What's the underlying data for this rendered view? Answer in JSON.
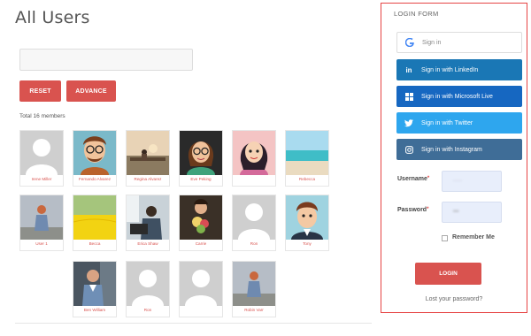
{
  "header": {
    "title": "All Users"
  },
  "search": {
    "value": "",
    "placeholder": ""
  },
  "filters": {
    "reset_label": "RESET",
    "advance_label": "ADVANCE"
  },
  "summary": {
    "total_text": "Total 16 members"
  },
  "members": [
    {
      "name": "Irene Miller",
      "photo": "default-avatar"
    },
    {
      "name": "Fernando Alvarez",
      "photo": "cartoon-man-glasses"
    },
    {
      "name": "Regina Alvarez",
      "photo": "woman-on-bench"
    },
    {
      "name": "Eve Peking",
      "photo": "cartoon-woman-glasses"
    },
    {
      "name": "",
      "photo": "cartoon-woman-dark-hair",
      "blurred": true
    },
    {
      "name": "Rebecca",
      "photo": "beach"
    },
    {
      "name": "User 1",
      "photo": "girl-back-view"
    },
    {
      "name": "Becca",
      "photo": "yellow-flower-field"
    },
    {
      "name": "Erica Shaw",
      "photo": "woman-at-desk"
    },
    {
      "name": "Carrie",
      "photo": "woman-with-flowers"
    },
    {
      "name": "Ron",
      "photo": "default-avatar"
    },
    {
      "name": "Tony",
      "photo": "cartoon-man-suit"
    },
    {
      "name": "Ben William",
      "photo": "man-in-office"
    },
    {
      "name": "Ron",
      "photo": "default-avatar"
    },
    {
      "name": "",
      "photo": "default-avatar",
      "blurred": true
    },
    {
      "name": "Robin Varr",
      "photo": "girl-back-view"
    }
  ],
  "login_form": {
    "title": "LOGIN FORM",
    "google_label": "Sign in",
    "linkedin_label": "Sign in with LinkedIn",
    "microsoft_label": "Sign in with Microsoft Live",
    "twitter_label": "Sign in with Twitter",
    "instagram_label": "Sign in with Instagram",
    "username_label": "Username",
    "password_label": "Password",
    "remember_label": "Remember Me",
    "login_label": "LOGIN",
    "lost_password": "Lost your password?"
  },
  "colors": {
    "accent_red": "#d9534f",
    "panel_border": "#e64444",
    "linkedin": "#1a77b5",
    "microsoft": "#1667c1",
    "twitter": "#2ea6ee",
    "instagram": "#3f6d97"
  }
}
